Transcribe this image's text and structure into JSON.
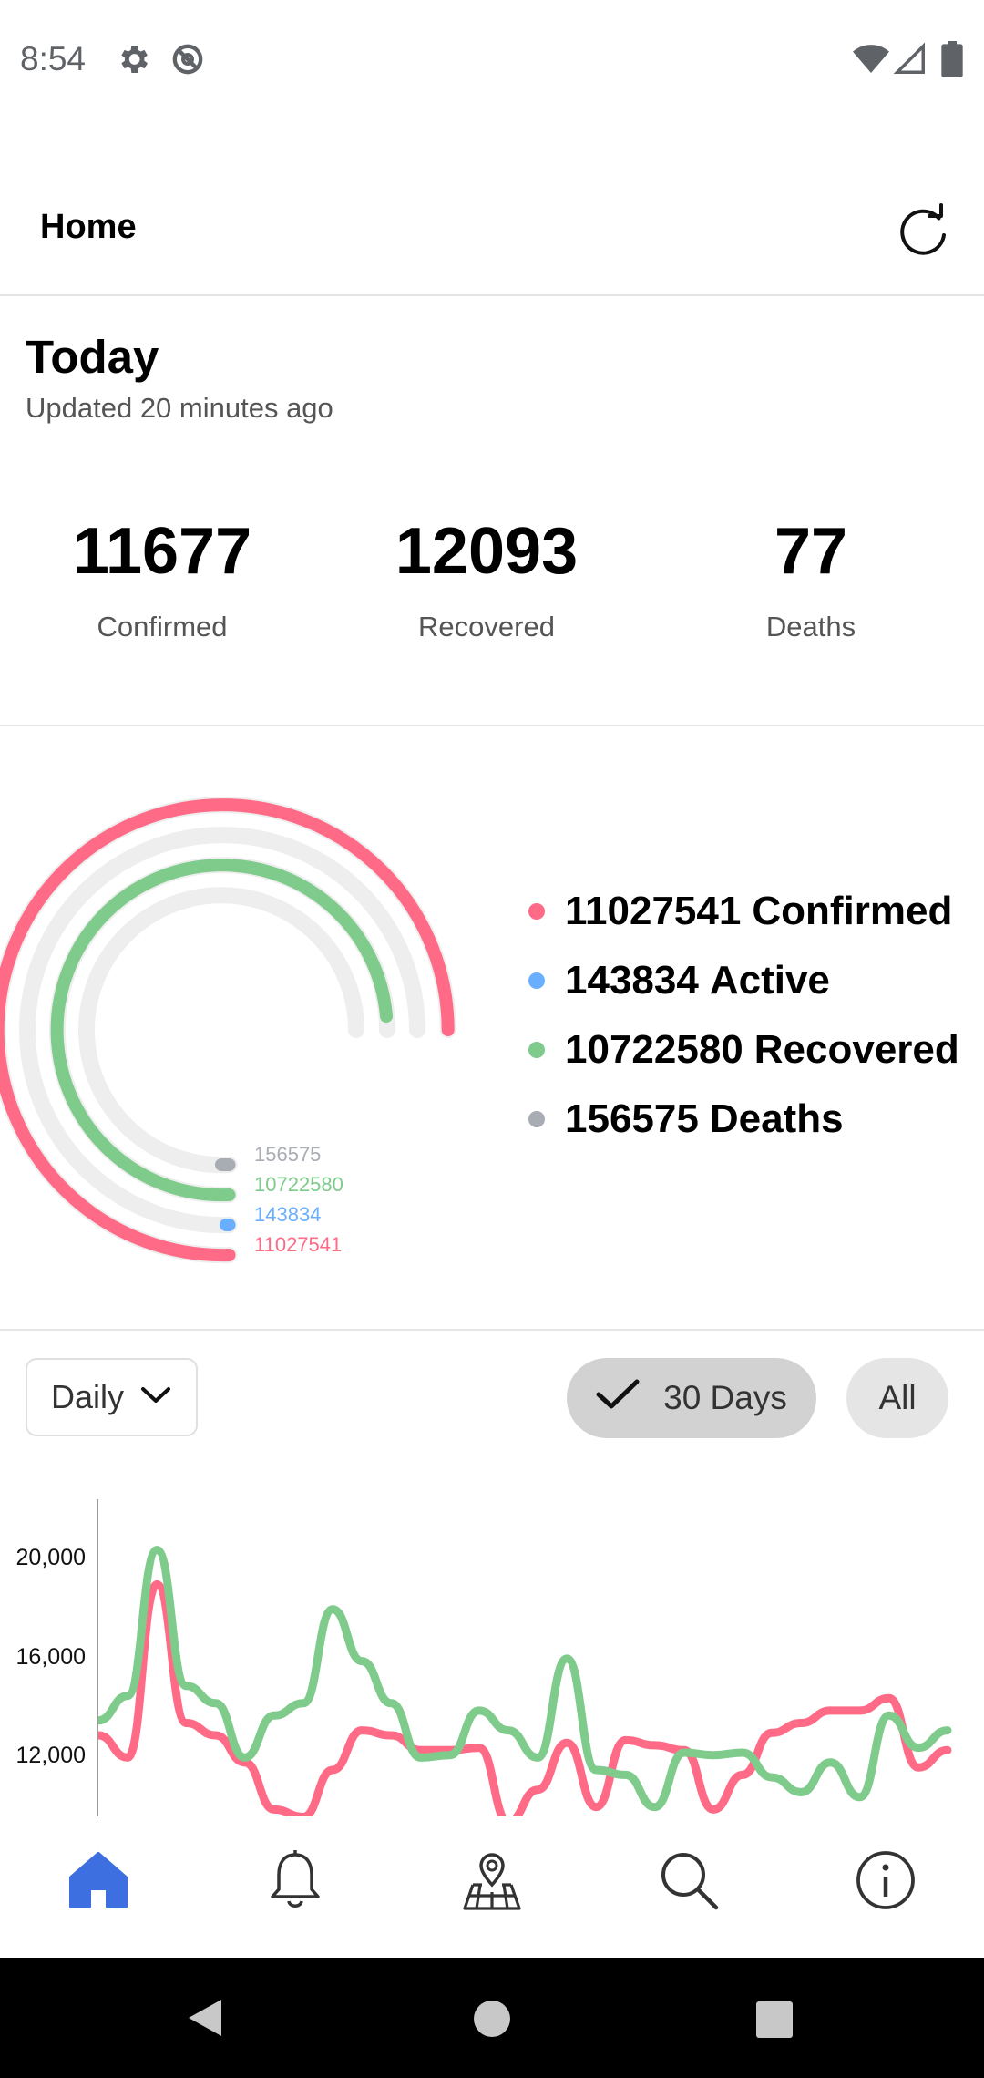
{
  "status_bar": {
    "time": "8:54"
  },
  "app_bar": {
    "title": "Home"
  },
  "today": {
    "title": "Today",
    "updated": "Updated 20 minutes ago"
  },
  "stats": [
    {
      "value": "11677",
      "label": "Confirmed"
    },
    {
      "value": "12093",
      "label": "Recovered"
    },
    {
      "value": "77",
      "label": "Deaths"
    }
  ],
  "colors": {
    "confirmed": "#ff6b87",
    "active": "#6aafff",
    "recovered": "#7ecb8b",
    "deaths": "#a8acb3",
    "track": "#eeeeee"
  },
  "totals": {
    "legend": [
      {
        "value": "11027541",
        "label": "Confirmed",
        "color": "#ff6b87"
      },
      {
        "value": "143834",
        "label": "Active",
        "color": "#6aafff"
      },
      {
        "value": "10722580",
        "label": "Recovered",
        "color": "#7ecb8b"
      },
      {
        "value": "156575",
        "label": "Deaths",
        "color": "#a8acb3"
      }
    ],
    "ring_labels": [
      {
        "value": "156575",
        "color": "#a8acb3"
      },
      {
        "value": "10722580",
        "color": "#7ecb8b"
      },
      {
        "value": "143834",
        "color": "#6aafff"
      },
      {
        "value": "11027541",
        "color": "#ff6b87"
      }
    ]
  },
  "filters": {
    "dropdown_label": "Daily",
    "chips": [
      {
        "label": "30 Days",
        "selected": true
      },
      {
        "label": "All",
        "selected": false
      }
    ]
  },
  "chart_data": {
    "type": "line",
    "y_ticks": [
      "20,000",
      "16,000",
      "12,000"
    ],
    "ylim": [
      10000,
      22000
    ],
    "series": [
      {
        "color": "#ff6b87",
        "values": [
          12700,
          11800,
          18800,
          13200,
          12700,
          11600,
          9700,
          9400,
          11300,
          12900,
          12700,
          12100,
          12100,
          12200,
          9200,
          10500,
          12400,
          9800,
          12500,
          12300,
          12100,
          9700,
          11100,
          12800,
          13200,
          13700,
          13700,
          14200,
          11400,
          12100
        ]
      },
      {
        "color": "#7ecb8b",
        "values": [
          13300,
          14300,
          20200,
          14700,
          14000,
          11800,
          13500,
          14000,
          17800,
          15700,
          14000,
          11800,
          11900,
          13700,
          12900,
          11800,
          15800,
          11300,
          11100,
          9800,
          12000,
          11900,
          12000,
          11000,
          10400,
          11600,
          10200,
          13500,
          12200,
          12900
        ]
      }
    ]
  }
}
